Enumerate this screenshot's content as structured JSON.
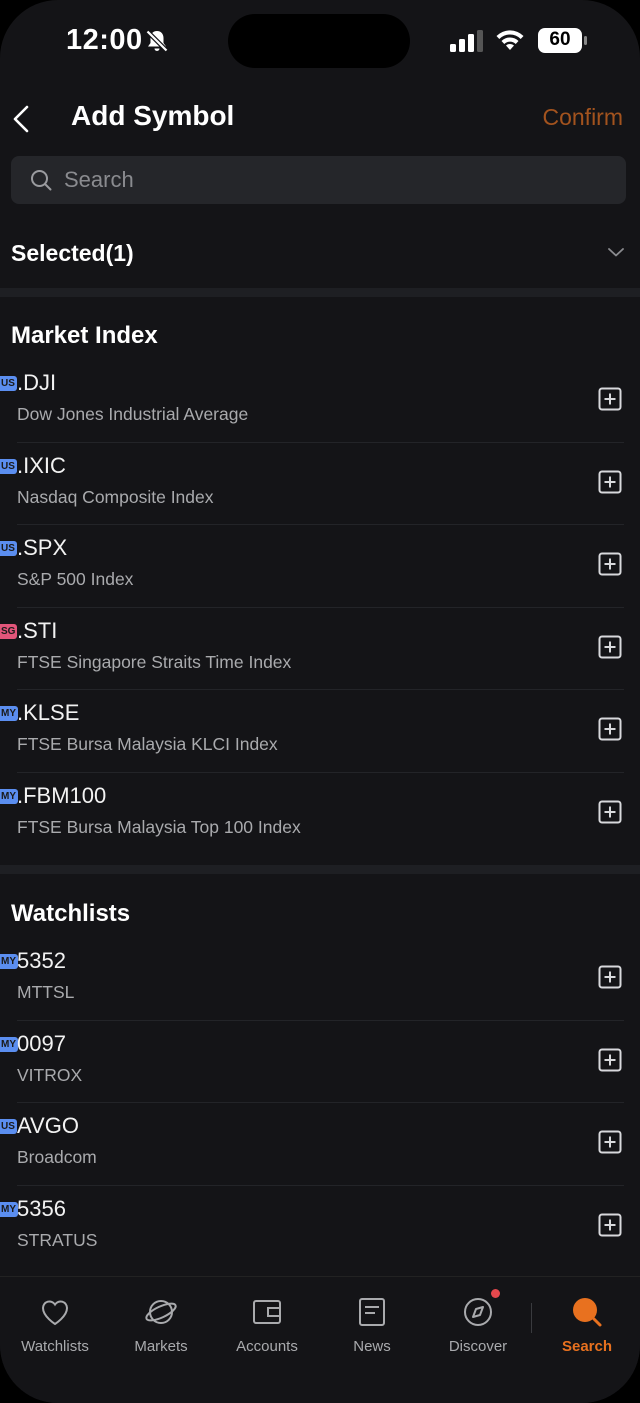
{
  "status_bar": {
    "time": "12:00",
    "battery": "60"
  },
  "header": {
    "title": "Add Symbol",
    "confirm_label": "Confirm"
  },
  "search": {
    "placeholder": "Search"
  },
  "selected": {
    "label": "Selected(1)"
  },
  "market_index": {
    "title": "Market Index",
    "items": [
      {
        "market": "US",
        "symbol": ".DJI",
        "name": "Dow Jones Industrial Average"
      },
      {
        "market": "US",
        "symbol": ".IXIC",
        "name": "Nasdaq Composite Index"
      },
      {
        "market": "US",
        "symbol": ".SPX",
        "name": "S&P 500 Index"
      },
      {
        "market": "SG",
        "symbol": ".STI",
        "name": "FTSE Singapore Straits Time Index"
      },
      {
        "market": "MY",
        "symbol": ".KLSE",
        "name": "FTSE Bursa Malaysia KLCI Index"
      },
      {
        "market": "MY",
        "symbol": ".FBM100",
        "name": "FTSE Bursa Malaysia Top 100 Index"
      }
    ]
  },
  "watchlists": {
    "title": "Watchlists",
    "items": [
      {
        "market": "MY",
        "symbol": "5352",
        "name": "MTTSL"
      },
      {
        "market": "MY",
        "symbol": "0097",
        "name": "VITROX"
      },
      {
        "market": "US",
        "symbol": "AVGO",
        "name": "Broadcom"
      },
      {
        "market": "MY",
        "symbol": "5356",
        "name": "STRATUS"
      }
    ]
  },
  "tabbar": {
    "tabs": [
      {
        "label": "Watchlists",
        "icon": "heart-icon"
      },
      {
        "label": "Markets",
        "icon": "planet-icon"
      },
      {
        "label": "Accounts",
        "icon": "wallet-icon"
      },
      {
        "label": "News",
        "icon": "newspaper-icon"
      },
      {
        "label": "Discover",
        "icon": "compass-icon"
      },
      {
        "label": "Search",
        "icon": "search-icon",
        "active": true
      }
    ]
  },
  "colors": {
    "accent": "#e8711f",
    "confirm": "#a3531e",
    "us_flag": "#5b8ef0",
    "sg_flag": "#e2557a",
    "background": "#141417"
  }
}
